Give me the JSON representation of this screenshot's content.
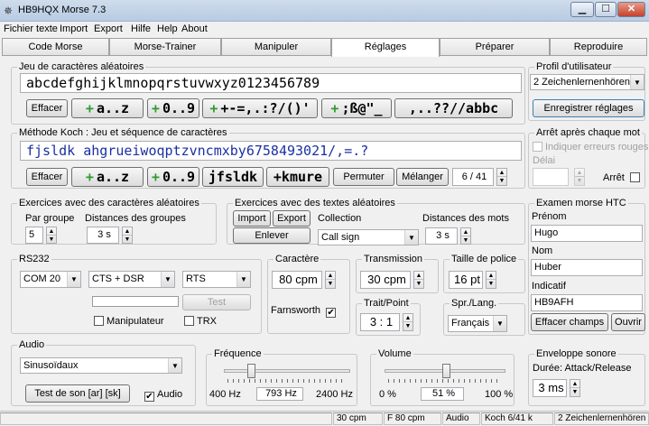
{
  "window": {
    "title": "HB9HQX Morse 7.3",
    "minimize": "▁",
    "maximize": "☐",
    "close": "✕"
  },
  "menu": [
    "Fichier texte",
    "Import",
    "Export",
    "Hilfe",
    "Help",
    "About"
  ],
  "tabs": [
    "Code Morse",
    "Morse-Trainer",
    "Manipuler",
    "Réglages",
    "Préparer",
    "Reproduire"
  ],
  "active_tab": "Réglages",
  "random_chars": {
    "title": "Jeu de caractères aléatoires",
    "text": "abcdefghijklmnopqrstuvwxyz0123456789",
    "clear": "Effacer",
    "buttons": [
      "a..z",
      "0..9",
      "+-=,.:?/()'",
      ";ß@\"_",
      ",..??//abbc"
    ]
  },
  "koch": {
    "title": "Méthode Koch : Jeu et séquence de caractères",
    "text": "fjsldk  ahgrueiwoqptzvncmxby6758493021/,=.?",
    "clear": "Effacer",
    "buttons": [
      "a..z",
      "0..9"
    ],
    "fjsldk": "jfsldk",
    "kmure": "+kmure",
    "permute": "Permuter",
    "shuffle": "Mélanger",
    "count": "6 / 41"
  },
  "random_exercises": {
    "title": "Exercices avec des caractères aléatoires",
    "group_label": "Par groupe",
    "group_value": "5",
    "distance_label": "Distances des groupes",
    "distance_value": "3 s"
  },
  "text_exercises": {
    "title": "Exercices avec des textes aléatoires",
    "import": "Import",
    "export": "Export",
    "remove": "Enlever",
    "collection_label": "Collection",
    "collection_value": "Call sign",
    "word_distance_label": "Distances des mots",
    "word_distance_value": "3 s"
  },
  "rs232": {
    "title": "RS232",
    "port": "COM 20",
    "handshake": "CTS + DSR",
    "line": "RTS",
    "test": "Test",
    "key_label": "Manipulateur",
    "trx_label": "TRX"
  },
  "character": {
    "title": "Caractère",
    "value": "80 cpm",
    "farnsworth": "Farnsworth",
    "farnsworth_checked": true
  },
  "transmission": {
    "title": "Transmission",
    "value": "30 cpm"
  },
  "font_size": {
    "title": "Taille de police",
    "value": "16 pt"
  },
  "dot_dash": {
    "title": "Trait/Point",
    "value": "3 : 1"
  },
  "language": {
    "title": "Spr./Lang.",
    "value": "Français"
  },
  "profile": {
    "title": "Profil d'utilisateur",
    "value": "2 Zeichenlernenhören",
    "save": "Enregistrer réglages"
  },
  "stop_after_word": {
    "title": "Arrêt après chaque mot",
    "show_errors": "Indiquer erreurs rouges",
    "delay_label": "Délai",
    "stop_label": "Arrêt"
  },
  "htc_exam": {
    "title": "Examen morse HTC",
    "first_name_label": "Prénom",
    "first_name": "Hugo",
    "name_label": "Nom",
    "name": "Huber",
    "callsign_label": "Indicatif",
    "callsign": "HB9AFH",
    "clear": "Effacer champs",
    "open": "Ouvrir"
  },
  "audio": {
    "title": "Audio",
    "waveform": "Sinusoïdaux",
    "test": "Test de son  [ar] [sk]",
    "audio_label": "Audio",
    "audio_checked": true
  },
  "frequency": {
    "title": "Fréquence",
    "min": "400 Hz",
    "value": "793 Hz",
    "max": "2400 Hz",
    "level": 0.197
  },
  "volume": {
    "title": "Volume",
    "min": "0 %",
    "value": "51 %",
    "max": "100 %",
    "level": 0.51
  },
  "envelope": {
    "title": "Enveloppe sonore",
    "label": "Durée: Attack/Release",
    "value": "3 ms"
  },
  "status": [
    "30 cpm",
    "F 80 cpm",
    "Audio",
    "Koch 6/41  k",
    "2 Zeichenlernenhören"
  ]
}
